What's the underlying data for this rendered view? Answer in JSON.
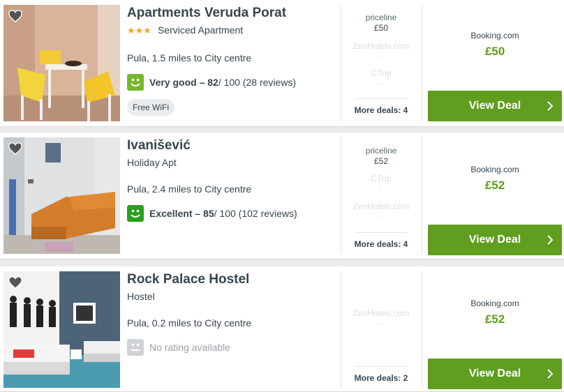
{
  "colors": {
    "accent_green": "#5f9e1e",
    "price_green": "#5d9d1a",
    "star": "#f5a623"
  },
  "hotels": [
    {
      "name": "Apartments Veruda Porat",
      "stars": "★★★",
      "type": "Serviced Apartment",
      "location": "Pula, 1.5 miles to City centre",
      "rating_word": "Very good – 82",
      "rating_rest": " / 100 (28 reviews)",
      "rating_color": "#77b82a",
      "amenity": "Free WiFi",
      "deals": [
        {
          "provider": "priceline",
          "price": "£50",
          "state": "active"
        },
        {
          "provider": "ZenHotels.com",
          "price": "-",
          "state": "inactive"
        },
        {
          "provider": "CTrip",
          "price": "-",
          "state": "inactive"
        }
      ],
      "more_deals": "More deals: 4",
      "best_provider": "Booking.com",
      "best_price": "£50",
      "cta": "View Deal",
      "photo_alt": "apartment dining room"
    },
    {
      "name": "Ivanišević",
      "stars": "",
      "type": "Holiday Apt",
      "location": "Pula, 2.4 miles to City centre",
      "rating_word": "Excellent – 85",
      "rating_rest": " / 100 (102 reviews)",
      "rating_color": "#28a01e",
      "amenity": "",
      "deals": [
        {
          "provider": "priceline",
          "price": "£52",
          "state": "active"
        },
        {
          "provider": "CTrip",
          "price": "-",
          "state": "inactive"
        },
        {
          "provider": "ZenHotels.com",
          "price": "-",
          "state": "inactive"
        }
      ],
      "more_deals": "More deals: 4",
      "best_provider": "Booking.com",
      "best_price": "£52",
      "cta": "View Deal",
      "photo_alt": "living room with orange sofa"
    },
    {
      "name": "Rock Palace Hostel",
      "stars": "",
      "type": "Hostel",
      "location": "Pula, 0.2 miles to City centre",
      "rating_word": "",
      "rating_rest": "No rating available",
      "rating_color": "#cfd3d6",
      "amenity": "",
      "deals": [
        {
          "provider": "ZenHotels.com",
          "price": "-",
          "state": "inactive"
        }
      ],
      "more_deals": "More deals: 2",
      "best_provider": "Booking.com",
      "best_price": "£52",
      "cta": "View Deal",
      "photo_alt": "hostel room with beds"
    }
  ]
}
